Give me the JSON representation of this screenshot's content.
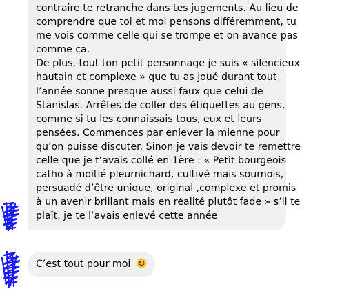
{
  "conversation": {
    "message_1": {
      "lines": [
        "contraire te retranche dans tes jugements. Au lieu de",
        "comprendre que toi et moi pensons différemment, tu",
        "me vois comme celle qui se trompe et on avance pas",
        "comme ça.",
        "De plus, tout ton petit personnage je suis « silencieux",
        "hautain et complexe » que tu as joué durant tout",
        "l’année sonne presque aussi faux que celui de",
        "Stanislas. Arrêtes de coller des étiquettes au gens,",
        "comme si tu les connaissais tous, eux et leurs",
        "pensées. Commences par enlever la mienne pour",
        "qu’on puisse discuter. Sinon je vais devoir te remettre",
        "celle que je t’avais collé en 1ère : «  Petit bourgeois",
        "catho à moitié pleurnichard, cultivé mais sournois,",
        "persuadé d’être unique, original ,complexe et promis",
        "à un avenir brillant mais en réalité plutôt fade » s’il te",
        "plaît, je te l’avais enlevé cette année"
      ]
    },
    "message_2": {
      "text": "C’est tout pour moi",
      "emoji_icon": "smiling-face-emoji"
    },
    "colors": {
      "bubble": "#f0f0f0",
      "text": "#050505",
      "avatar_scribble": "#1a1aff",
      "emoji": "#f7c23a"
    }
  }
}
